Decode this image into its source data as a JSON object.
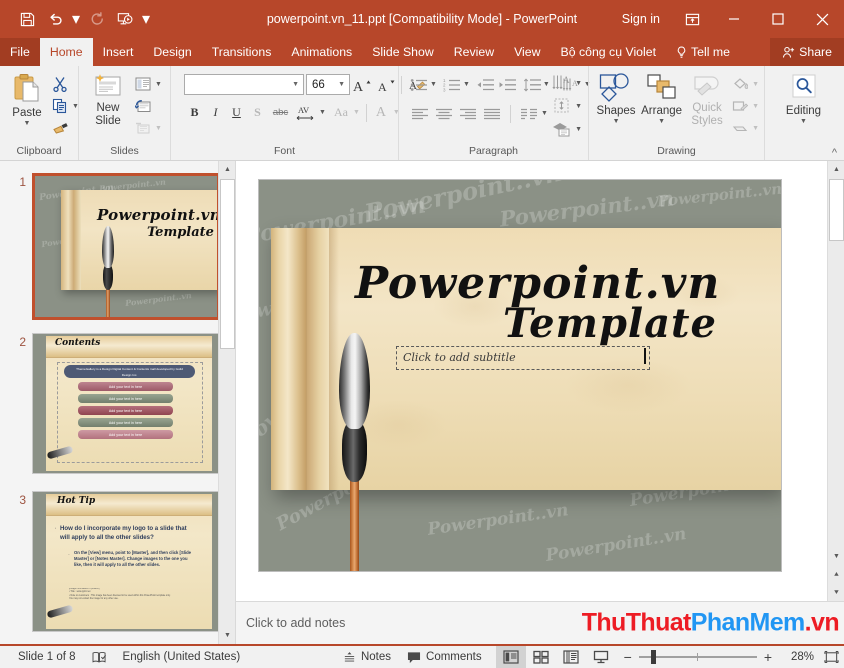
{
  "titlebar": {
    "document_title": "powerpoint.vn_11.ppt [Compatibility Mode]  -  PowerPoint",
    "sign_in": "Sign in",
    "qat": [
      {
        "name": "save",
        "label": "Save"
      },
      {
        "name": "undo",
        "label": "Undo"
      },
      {
        "name": "redo",
        "label": "Redo"
      },
      {
        "name": "start-from-beginning",
        "label": "Start From Beginning"
      },
      {
        "name": "customize-quick-access-toolbar",
        "label": "Customize Quick Access Toolbar"
      }
    ],
    "window_controls": [
      {
        "name": "ribbon-display-options",
        "label": "Ribbon Display Options"
      },
      {
        "name": "minimize",
        "label": "Minimize"
      },
      {
        "name": "maximize",
        "label": "Maximize"
      },
      {
        "name": "close",
        "label": "Close"
      }
    ]
  },
  "tabs": [
    {
      "label": "File",
      "active": false
    },
    {
      "label": "Home",
      "active": true
    },
    {
      "label": "Insert",
      "active": false
    },
    {
      "label": "Design",
      "active": false
    },
    {
      "label": "Transitions",
      "active": false
    },
    {
      "label": "Animations",
      "active": false
    },
    {
      "label": "Slide Show",
      "active": false
    },
    {
      "label": "Review",
      "active": false
    },
    {
      "label": "View",
      "active": false
    },
    {
      "label": "Bộ công cụ Violet",
      "active": false
    }
  ],
  "tell_me": "Tell me",
  "share": "Share",
  "ribbon": {
    "clipboard": {
      "label": "Clipboard",
      "paste": "Paste",
      "cut": "Cut",
      "copy": "Copy",
      "format_painter": "Format Painter"
    },
    "slides": {
      "label": "Slides",
      "new_slide": "New Slide",
      "layout": "Layout",
      "reset": "Reset",
      "section": "Section"
    },
    "font": {
      "label": "Font",
      "font_name_value": "",
      "font_name_placeholder": "",
      "font_size_value": "66",
      "buttons": [
        {
          "name": "bold",
          "label": "B"
        },
        {
          "name": "italic",
          "label": "I"
        },
        {
          "name": "underline",
          "label": "U"
        },
        {
          "name": "shadow",
          "label": "S"
        },
        {
          "name": "strikethrough",
          "label": "abc"
        },
        {
          "name": "character-spacing",
          "label": "AV"
        },
        {
          "name": "change-case",
          "label": "Aa"
        },
        {
          "name": "font-color",
          "label": "A"
        }
      ],
      "increase_font": "A",
      "decrease_font": "A",
      "clear_formatting": "Clear All Formatting"
    },
    "paragraph": {
      "label": "Paragraph",
      "buttons": [
        {
          "name": "bullets"
        },
        {
          "name": "numbering"
        },
        {
          "name": "decrease-indent"
        },
        {
          "name": "increase-indent"
        },
        {
          "name": "line-spacing"
        },
        {
          "name": "text-direction"
        },
        {
          "name": "align-text"
        },
        {
          "name": "convert-to-smartart"
        },
        {
          "name": "align-left"
        },
        {
          "name": "center"
        },
        {
          "name": "align-right"
        },
        {
          "name": "justify"
        },
        {
          "name": "columns"
        }
      ]
    },
    "drawing": {
      "label": "Drawing",
      "shapes": "Shapes",
      "arrange": "Arrange",
      "quick_styles": "Quick Styles",
      "shape_fill": "Shape Fill",
      "shape_outline": "Shape Outline",
      "shape_effects": "Shape Effects"
    },
    "editing": {
      "label": "Editing",
      "editing_button": "Editing",
      "collapse_ribbon": "Collapse the Ribbon"
    }
  },
  "thumbnails": [
    {
      "number": "1",
      "selected": true,
      "type": "title",
      "title": "Powerpoint.vn",
      "subtitle": "Template"
    },
    {
      "number": "2",
      "selected": false,
      "type": "contents",
      "title": "Contents",
      "banner": "ThemeGallery is a Design Digital Content & Contents mall developed by Guild Design Inc.",
      "bars": [
        {
          "text": "Add your text in here",
          "color": "#a9717d"
        },
        {
          "text": "Add your text in here",
          "color": "#7f8d7a"
        },
        {
          "text": "Add your text in here",
          "color": "#a2555e"
        },
        {
          "text": "Add your text in here",
          "color": "#7f8d7a"
        },
        {
          "text": "Add your text in here",
          "color": "#c08b94"
        }
      ]
    },
    {
      "number": "3",
      "selected": false,
      "type": "hottip",
      "title": "Hot Tip",
      "question": "How do I incorporate my logo to a slide that will apply to all the other slides?",
      "answer": "On the [View] menu, point to [Master], and then click [Slide Master] or [Notes Master]. Change images to the one you like, then it will apply to all the other slides."
    }
  ],
  "slide": {
    "title_line1": "Powerpoint.vn",
    "title_line2": "Template",
    "subtitle_placeholder": "Click to add subtitle",
    "background_watermark_text": "Powerpoint..vn",
    "background_color": "#8b9186",
    "paper_color": "#efdcb4"
  },
  "notes": {
    "placeholder": "Click to add notes"
  },
  "watermark": {
    "part1": "ThuThuat",
    "part2": "PhanMem",
    "part3": ".vn",
    "color1": "#ed1c24",
    "color2": "#2196f3"
  },
  "statusbar": {
    "slide_indicator": "Slide 1 of 8",
    "spellcheck_label": "Spell check",
    "language": "English (United States)",
    "notes": "Notes",
    "comments": "Comments",
    "views": [
      {
        "name": "normal-view",
        "label": "Normal",
        "active": true
      },
      {
        "name": "slide-sorter-view",
        "label": "Slide Sorter",
        "active": false
      },
      {
        "name": "reading-view",
        "label": "Reading View",
        "active": false
      },
      {
        "name": "slide-show-view",
        "label": "Slide Show",
        "active": false
      }
    ],
    "zoom_out": "−",
    "zoom_in": "+",
    "zoom_level": "28%",
    "fit_to_window": "Fit slide to current window"
  },
  "colors": {
    "accent": "#b7472a",
    "accent_dark": "#a23d22",
    "ribbon_bg": "#f1f1f1"
  }
}
